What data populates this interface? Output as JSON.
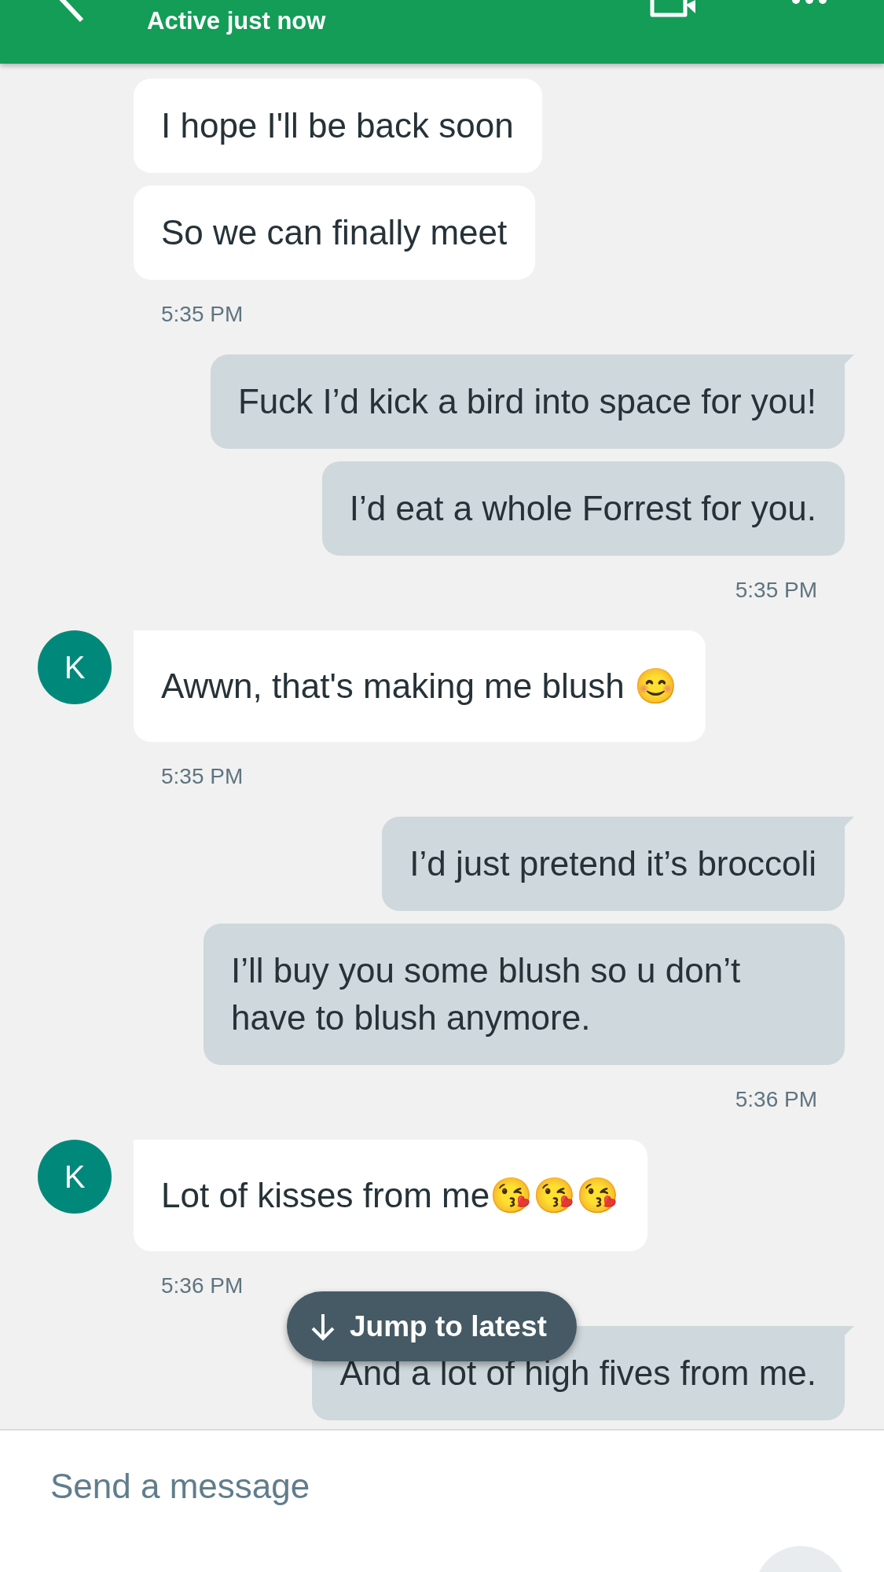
{
  "header": {
    "status": "Active just now"
  },
  "messages": [
    {
      "kind": "received",
      "text": "I hope I'll be back soon"
    },
    {
      "kind": "received",
      "text": "So we can finally meet"
    },
    {
      "kind": "time_received",
      "text": "5:35 PM"
    },
    {
      "kind": "sent",
      "text": "Fuck I’d kick a bird into space for you!",
      "tail": true
    },
    {
      "kind": "sent",
      "text": "I’d eat a whole Forrest for you.",
      "tail": false
    },
    {
      "kind": "time_sent",
      "text": "5:35 PM"
    },
    {
      "kind": "received",
      "text": "Awwn, that's making me blush 😊",
      "avatar": "K"
    },
    {
      "kind": "time_received",
      "text": "5:35 PM"
    },
    {
      "kind": "sent",
      "text": "I’d just pretend it’s broccoli",
      "tail": true
    },
    {
      "kind": "sent",
      "text": "I’ll buy you some blush so u don’t have to blush anymore.",
      "tail": false
    },
    {
      "kind": "time_sent",
      "text": "5:36 PM"
    },
    {
      "kind": "received",
      "text": "Lot of kisses from me😘😘😘",
      "avatar": "K"
    },
    {
      "kind": "time_received",
      "text": "5:36 PM"
    },
    {
      "kind": "sent",
      "text": "And a lot of high fives from me.",
      "tail": true
    }
  ],
  "jump_button": {
    "label": "Jump to latest"
  },
  "composer": {
    "placeholder": "Send a message"
  }
}
